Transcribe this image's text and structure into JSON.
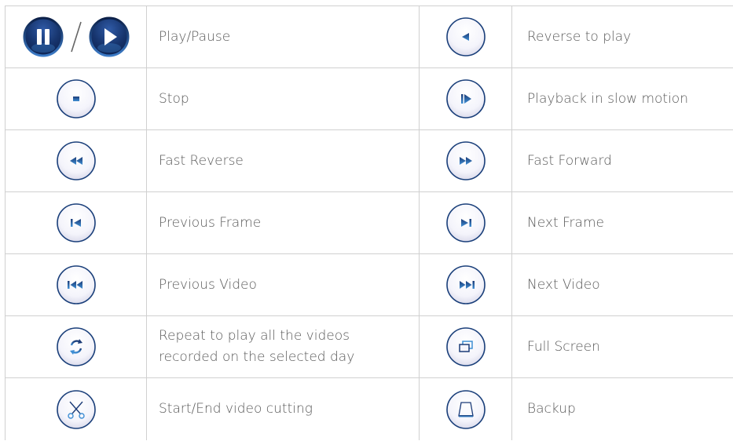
{
  "rows": [
    {
      "left_icon": "play-pause-icons",
      "left_label": "Play/Pause",
      "right_icon": "reverse-play-icon",
      "right_label": "Reverse to play"
    },
    {
      "left_icon": "stop-icon",
      "left_label": "Stop",
      "right_icon": "slow-motion-icon",
      "right_label": "Playback in slow motion"
    },
    {
      "left_icon": "fast-reverse-icon",
      "left_label": "Fast Reverse",
      "right_icon": "fast-forward-icon",
      "right_label": "Fast Forward"
    },
    {
      "left_icon": "previous-frame-icon",
      "left_label": "Previous Frame",
      "right_icon": "next-frame-icon",
      "right_label": "Next Frame"
    },
    {
      "left_icon": "previous-video-icon",
      "left_label": "Previous Video",
      "right_icon": "next-video-icon",
      "right_label": "Next Video"
    },
    {
      "left_icon": "repeat-icon",
      "left_label_line1": "Repeat to play all the videos",
      "left_label_line2": "recorded on the selected day",
      "right_icon": "full-screen-icon",
      "right_label": "Full Screen"
    },
    {
      "left_icon": "scissors-icon",
      "left_label": "Start/End video cutting",
      "right_icon": "backup-icon",
      "right_label": "Backup"
    }
  ],
  "colors": {
    "accent": "#1a3f7a",
    "border": "#d0d0d0",
    "text": "#5a5a5a"
  }
}
